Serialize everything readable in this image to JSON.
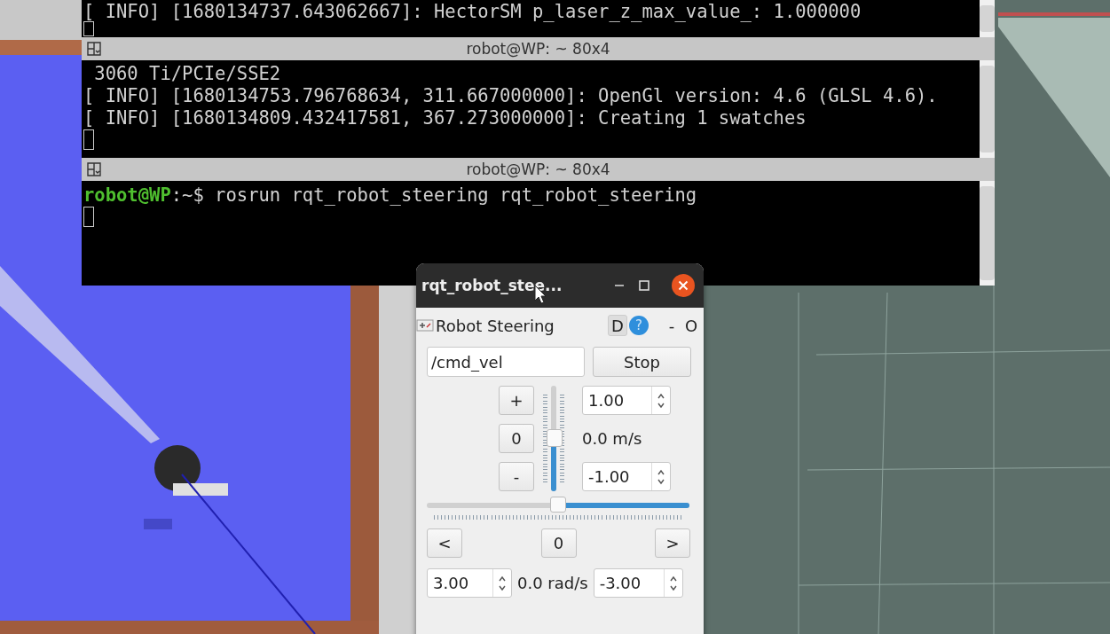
{
  "terminal": {
    "panes": [
      {
        "lines": [
          "[ INFO] [1680134737.643062667]: HectorSM p_laser_z_max_value_: 1.000000"
        ]
      },
      {
        "title": "robot@WP: ~ 80x4",
        "lines": [
          " 3060 Ti/PCIe/SSE2",
          "[ INFO] [1680134753.796768634, 311.667000000]: OpenGl version: 4.6 (GLSL 4.6).",
          "[ INFO] [1680134809.432417581, 367.273000000]: Creating 1 swatches"
        ]
      },
      {
        "title": "robot@WP: ~ 80x4",
        "prompt": "robot@WP",
        "command": ":~$ rosrun rqt_robot_steering rqt_robot_steering"
      }
    ]
  },
  "dialog": {
    "title": "rqt_robot_stee...",
    "plugin_title": "Robot Steering",
    "plugin_buttons": [
      {
        "kind": "text",
        "label": "D"
      },
      {
        "kind": "help",
        "label": "?"
      },
      {
        "kind": "flat",
        "label": "-"
      },
      {
        "kind": "flat",
        "label": "O"
      }
    ],
    "topic": "/cmd_vel",
    "stop_label": "Stop",
    "linear": {
      "plus": "+",
      "zero": "0",
      "minus": "-",
      "max": "1.00",
      "min": "-1.00",
      "reading": "0.0 m/s",
      "level": 0.5
    },
    "angular": {
      "left": "<",
      "zero": "0",
      "right": ">",
      "max": "3.00",
      "min": "-3.00",
      "reading": "0.0 rad/s",
      "level": 0.5
    }
  }
}
